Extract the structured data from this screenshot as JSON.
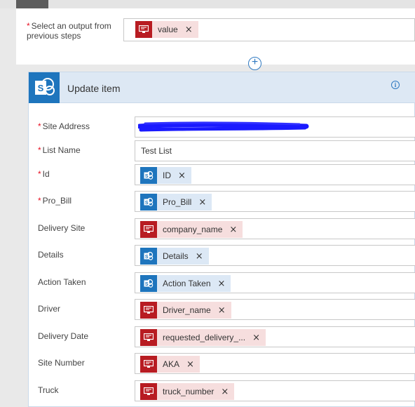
{
  "prev_step": {
    "label": "Select an output from previous steps",
    "token": "value"
  },
  "action": {
    "title": "Update item",
    "info_icon": "i"
  },
  "fields": [
    {
      "label": "Site Address",
      "required": true,
      "type": "redacted"
    },
    {
      "label": "List Name",
      "required": true,
      "type": "text",
      "value": "Test List"
    },
    {
      "label": "Id",
      "required": true,
      "type": "token",
      "kind": "sp",
      "token": "ID"
    },
    {
      "label": "Pro_Bill",
      "required": true,
      "type": "token",
      "kind": "sp",
      "token": "Pro_Bill"
    },
    {
      "label": "Delivery Site",
      "required": false,
      "type": "token",
      "kind": "red",
      "token": "company_name"
    },
    {
      "label": "Details",
      "required": false,
      "type": "token",
      "kind": "sp",
      "token": "Details"
    },
    {
      "label": "Action Taken",
      "required": false,
      "type": "token",
      "kind": "sp",
      "token": "Action Taken"
    },
    {
      "label": "Driver",
      "required": false,
      "type": "token",
      "kind": "red",
      "token": "Driver_name"
    },
    {
      "label": "Delivery Date",
      "required": false,
      "type": "token",
      "kind": "red",
      "token": "requested_delivery_..."
    },
    {
      "label": "Site Number",
      "required": false,
      "type": "token",
      "kind": "red",
      "token": "AKA"
    },
    {
      "label": "Truck",
      "required": false,
      "type": "token",
      "kind": "red",
      "token": "truck_number"
    }
  ],
  "colors": {
    "sharepoint_blue": "#1e75bd",
    "token_red": "#b81c22",
    "required_red": "#e81123",
    "redaction_blue": "#1a1aff"
  }
}
